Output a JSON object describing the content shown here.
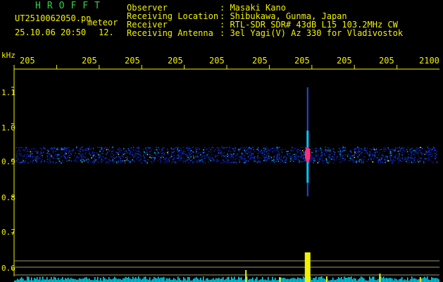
{
  "header": {
    "logo": "HROFFT",
    "file_name": "UT2510062050.pn",
    "event_label": "meteor",
    "date_time": "25.10.06 20:50",
    "count": "12.",
    "observer_label": "Observer",
    "observer_value": ": Masaki Kano",
    "location_label": "Receiving Location",
    "location_value": ": Shibukawa, Gunma, Japan",
    "receiver_label": "Receiver",
    "receiver_value": ": RTL-SDR SDR# 43dB L15 103.2MHz CW",
    "antenna_label": "Receiving Antenna",
    "antenna_value": ": 3el Yagi(V) Az 330 for Vladivostok"
  },
  "colors": {
    "text": "#f2f200",
    "logo": "#33d04a",
    "background": "#000000",
    "spectrum": "#00e5ff",
    "event": "#ff2d7a"
  },
  "chart_data": {
    "type": "heatmap",
    "y_unit_label": "kHz",
    "y_ticks": [
      "1.1",
      "1.0",
      "0.9",
      "0.8",
      "0.7",
      "0.6"
    ],
    "x_ticks": [
      "205",
      "205",
      "205",
      "205",
      "205",
      "205",
      "205",
      "205",
      "205",
      "2100"
    ],
    "ylim": [
      0.58,
      1.15
    ],
    "xlim": [
      0,
      10
    ],
    "background_band": {
      "center": 0.915,
      "half_width": 0.02
    },
    "events": [
      {
        "x": 6.9,
        "y_center": 0.915,
        "y_min": 0.8,
        "y_max": 1.1,
        "color": "#ff2d7a"
      }
    ],
    "spikes": [
      {
        "x": 5.45,
        "height": 0.17
      },
      {
        "x": 6.25,
        "height": 0.07
      },
      {
        "x": 6.9,
        "height": 0.42
      },
      {
        "x": 7.35,
        "height": 0.08
      },
      {
        "x": 8.6,
        "height": 0.12
      },
      {
        "x": 9.55,
        "height": 0.07
      }
    ]
  }
}
